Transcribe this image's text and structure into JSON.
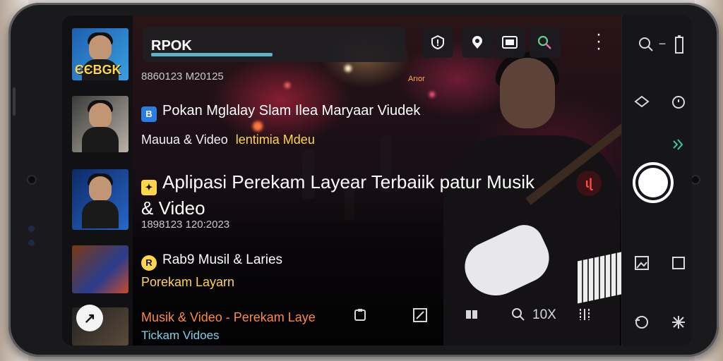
{
  "search": {
    "value": "RPOK"
  },
  "scene": {
    "tag": "Arıor"
  },
  "toolbar": {
    "icons": [
      "alert-shield-icon",
      "location-pin-icon",
      "cast-icon",
      "key-search-icon",
      "more-vertical-icon"
    ]
  },
  "list": {
    "items": [
      {
        "meta": "8860123 M20125",
        "thumb_text": "ЄЄBGK"
      },
      {
        "title": "Pokan Mglalay Slam Ilea Maryaar Viudek",
        "title_red": "Slam Ilea",
        "subtitle": "Mauua & Video",
        "subtitle_accent": "lentimia Mdeu"
      },
      {
        "title": "Aplipasi Perekam Layear Terbaiik patur Musik & Video",
        "meta": "1898123 120:2023"
      },
      {
        "title": "Rab9 Musil & Laries",
        "subtitle": "Porekam Layarn"
      },
      {
        "title": "Musik & Video - Perekam Laye",
        "subtitle": "Tickam Vidoes"
      }
    ]
  },
  "overlay": {
    "label": "↗"
  },
  "bottom_bar": {
    "zoom_label": "10X"
  },
  "right_controls": {
    "top": {
      "search": "search-icon",
      "minus": "−"
    },
    "record_label": "ɩɭ"
  },
  "colors": {
    "accent_blue": "#5db3c8",
    "accent_yellow": "#ffd54a",
    "accent_orange": "#ff8a3d",
    "accent_red": "#e53935",
    "cyan_text": "#7fd1e8"
  }
}
